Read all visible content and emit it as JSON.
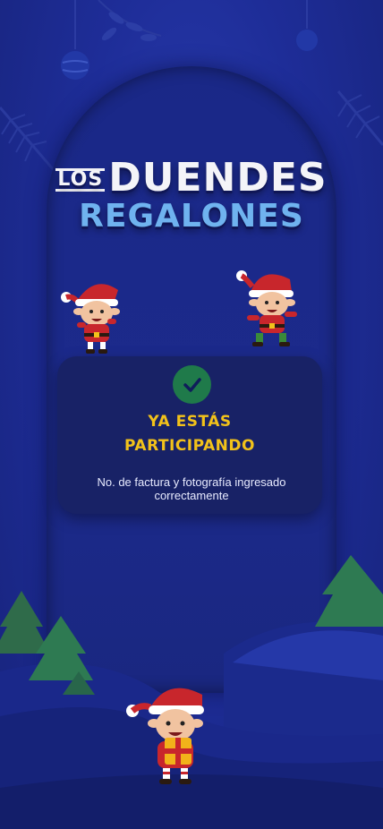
{
  "title": {
    "los": "LOS",
    "line1": "DUENDES",
    "line2": "REGALONES"
  },
  "status": {
    "line1": "YA ESTÁS",
    "line2": "PARTICIPANDO"
  },
  "message": {
    "line1": "No. de factura y fotografía ingresado",
    "line2": "correctamente"
  },
  "colors": {
    "background": "#1f2f9a",
    "accent": "#f2c21a",
    "success": "#1f7a4a",
    "title_blue": "#6fb3ef"
  },
  "icons": [
    "check-icon",
    "ornament-icon",
    "leaf-icon",
    "tree-icon",
    "elf-icon",
    "gift-icon"
  ]
}
